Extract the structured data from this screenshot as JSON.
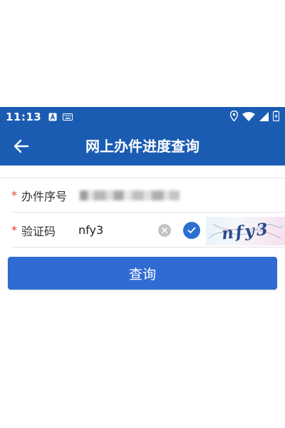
{
  "status_bar": {
    "time": "11:13",
    "icons": [
      "text-a-icon",
      "keyboard-icon",
      "location-icon",
      "wifi-icon",
      "signal-icon",
      "battery-icon"
    ]
  },
  "header": {
    "title": "网上办件进度查询",
    "back_icon": "arrow-left-icon"
  },
  "form": {
    "fields": [
      {
        "required_mark": "*",
        "label": "办件序号",
        "value": ""
      },
      {
        "required_mark": "*",
        "label": "验证码",
        "value": "nfy3",
        "captcha_text": "nfy3"
      }
    ]
  },
  "query_button": {
    "label": "查询"
  },
  "colors": {
    "primary": "#1b5cb3",
    "button": "#2f6bd3",
    "required": "#e53935",
    "check": "#2c6fd1"
  }
}
